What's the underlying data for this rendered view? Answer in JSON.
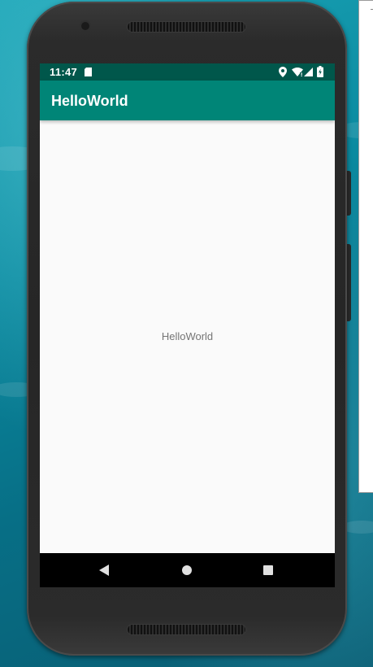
{
  "status_bar": {
    "time": "11:47",
    "icons": [
      "sd-card-icon",
      "location-icon",
      "wifi-icon",
      "cell-signal-icon",
      "battery-charging-icon"
    ]
  },
  "app_bar": {
    "title": "HelloWorld"
  },
  "content": {
    "text": "HelloWorld"
  },
  "nav_bar": {
    "buttons": [
      "back-icon",
      "home-icon",
      "recents-icon"
    ]
  },
  "colors": {
    "status_bar": "#00574b",
    "app_bar": "#008577",
    "screen_background": "#fafafa",
    "content_text": "#757575",
    "nav_bar": "#000000",
    "phone_body": "#262626"
  }
}
